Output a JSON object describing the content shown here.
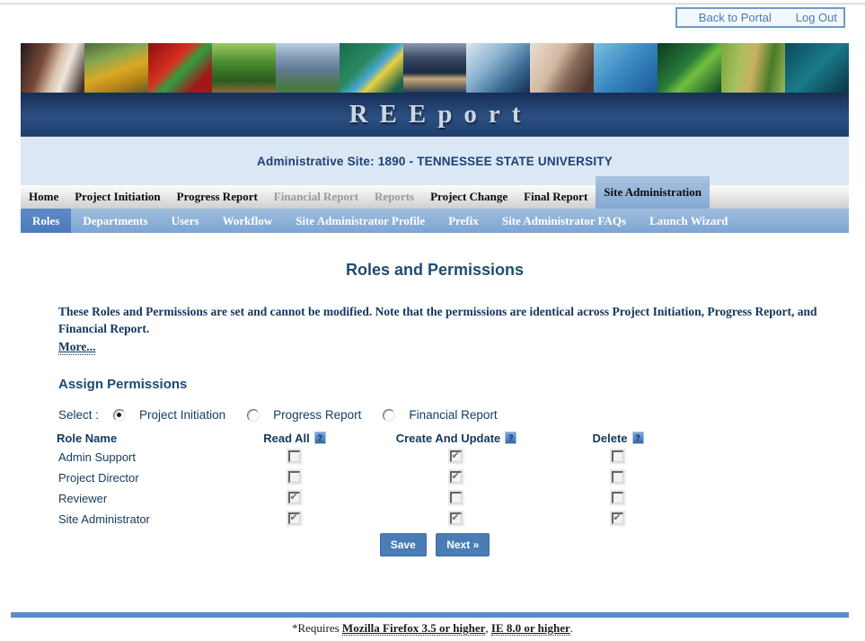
{
  "topbar": {
    "back_to_portal": "Back to Portal",
    "log_out": "Log Out"
  },
  "banner": {
    "logo": "REEport",
    "photos": [
      {
        "name": "scientist-with-flask",
        "gradient": "linear-gradient(110deg,#2e2020 5%,#7a4a3a 35%,#d9c1a9 55%,#efe7df 68%,#403028 95%)"
      },
      {
        "name": "excavator",
        "gradient": "linear-gradient(160deg,#49683a 0%,#85a751 30%,#d9a926 55%,#b98818 75%,#6a5a20 100%)"
      },
      {
        "name": "red-flowers-frog",
        "gradient": "linear-gradient(135deg,#8a1010,#d83020 40%,#2fa040 55%,#a01818 80%)"
      },
      {
        "name": "sunlit-forest",
        "gradient": "linear-gradient(180deg,#9bc961 0%,#4a8a30 40%,#2a5a1e 75%,#8a6a3a 100%)"
      },
      {
        "name": "mountain-peaks",
        "gradient": "linear-gradient(180deg,#b9cde1 0%,#8199b1 30%,#607890 55%,#4a7a4a 85%)"
      },
      {
        "name": "blue-tit-bird",
        "gradient": "linear-gradient(135deg,#1a6a50,#2a8a60 40%,#4aa8d8 55%,#e8d040 65%,#186048 90%)"
      },
      {
        "name": "cows-at-pond",
        "gradient": "linear-gradient(180deg,#8a9ab0 0%,#3a4a66 30%,#1a2a44 60%,#c8a878 72%,#2a3a50 100%)"
      },
      {
        "name": "waterfall",
        "gradient": "linear-gradient(135deg,#dde8f1,#88b0cc 40%,#3a6a94 70%,#16304e)"
      },
      {
        "name": "microscope-scientist",
        "gradient": "linear-gradient(120deg,#e9ded1,#d1b9a1 40%,#886858 62%,#503830 88%)"
      },
      {
        "name": "dolphins",
        "gradient": "linear-gradient(135deg,#7ac0e0,#3a88c0 50%,#1a5898)"
      },
      {
        "name": "green-snake",
        "gradient": "linear-gradient(135deg,#0a3a20,#2a7a3a 45%,#70c040 60%,#0e4424)"
      },
      {
        "name": "aerial-farmland",
        "gradient": "linear-gradient(100deg,#7aa83a,#a8c060 30%,#c8b060 50%,#4a7a28 75%,#98b858)"
      },
      {
        "name": "teal-coast",
        "gradient": "linear-gradient(135deg,#0a4a5a,#1a7a8a 50%,#0a3444)"
      }
    ]
  },
  "site_banner": "Administrative Site: 1890 - TENNESSEE STATE UNIVERSITY",
  "main_nav": {
    "items": [
      {
        "label": "Home",
        "state": "normal"
      },
      {
        "label": "Project Initiation",
        "state": "normal"
      },
      {
        "label": "Progress Report",
        "state": "normal"
      },
      {
        "label": "Financial Report",
        "state": "disabled"
      },
      {
        "label": "Reports",
        "state": "disabled"
      },
      {
        "label": "Project Change",
        "state": "normal"
      },
      {
        "label": "Final Report",
        "state": "normal"
      },
      {
        "label": "Site Administration",
        "state": "selected"
      }
    ]
  },
  "sub_nav": {
    "items": [
      {
        "label": "Roles",
        "state": "selected"
      },
      {
        "label": "Departments",
        "state": "normal"
      },
      {
        "label": "Users",
        "state": "normal"
      },
      {
        "label": "Workflow",
        "state": "normal"
      },
      {
        "label": "Site Administrator Profile",
        "state": "normal"
      },
      {
        "label": "Prefix",
        "state": "normal"
      },
      {
        "label": "Site Administrator FAQs",
        "state": "normal"
      },
      {
        "label": "Launch Wizard",
        "state": "normal"
      }
    ]
  },
  "page": {
    "title": "Roles and Permissions",
    "intro": "These Roles and Permissions are set and cannot be modified.  Note that the permissions are identical across Project Initiation, Progress Report, and Financial Report.",
    "more_link": "More...",
    "section_heading": "Assign Permissions",
    "select_label": "Select :",
    "report_options": [
      {
        "label": "Project Initiation",
        "selected": true
      },
      {
        "label": "Progress Report",
        "selected": false
      },
      {
        "label": "Financial Report",
        "selected": false
      }
    ],
    "permissions_table": {
      "role_header": "Role Name",
      "columns": [
        {
          "label": "Read All",
          "help_icon": true
        },
        {
          "label": "Create And Update",
          "help_icon": true
        },
        {
          "label": "Delete",
          "help_icon": true
        }
      ],
      "rows": [
        {
          "role": "Admin Support",
          "read_all": false,
          "create_and_update": true,
          "delete": false
        },
        {
          "role": "Project Director",
          "read_all": false,
          "create_and_update": true,
          "delete": false
        },
        {
          "role": "Reviewer",
          "read_all": true,
          "create_and_update": false,
          "delete": false
        },
        {
          "role": "Site Administrator",
          "read_all": true,
          "create_and_update": true,
          "delete": true
        }
      ]
    },
    "save_button": "Save",
    "next_button": "Next »"
  },
  "footer": {
    "prefix": "*Requires ",
    "firefox_link": "Mozilla Firefox 3.5 or higher",
    "separator": ", ",
    "ie_link": "IE 8.0 or higher",
    "suffix": "."
  },
  "colors": {
    "accent_blue": "#4a7cb5",
    "nav_selected": "#8db2d9",
    "subnav_selected": "#5586c6",
    "footer_bar": "#5c8cc2",
    "admin_band": "#dbe7f4",
    "logo_band": "#2b4f81"
  }
}
